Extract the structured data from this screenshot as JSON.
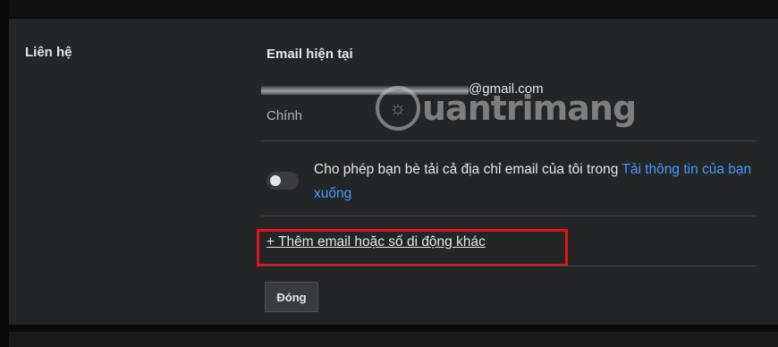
{
  "contact": {
    "section_label": "Liên hệ",
    "field_title": "Email hiện tại",
    "email_visible": "@gmail.com",
    "primary_label": "Chính",
    "toggle_text": "Cho phép bạn bè tải cả địa chỉ email của tôi trong ",
    "toggle_link": "Tải thông tin của bạn xuống",
    "toggle_on": false,
    "add_email_link": "+ Thêm email hoặc số di động khác",
    "close_button": "Đóng"
  },
  "watermark": {
    "text": "uantrimang"
  },
  "colors": {
    "background": "#242526",
    "link": "#4599ff",
    "highlight": "#e2131b"
  }
}
